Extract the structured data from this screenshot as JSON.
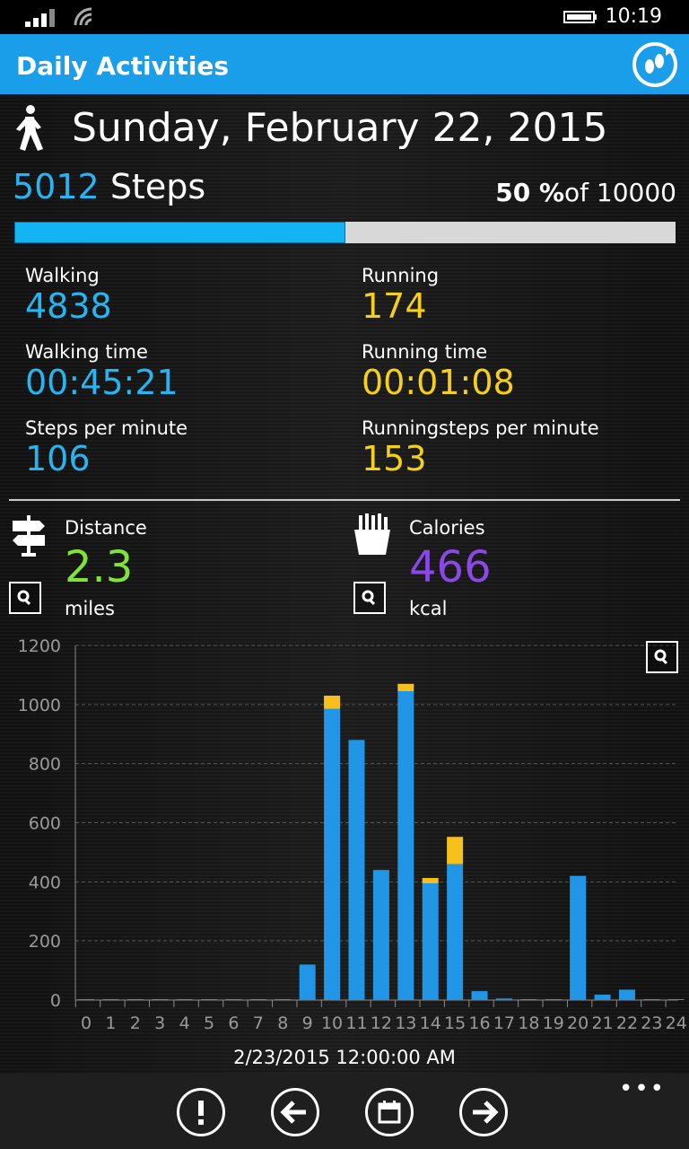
{
  "status": {
    "time": "10:19"
  },
  "header": {
    "title": "Daily Activities"
  },
  "date": "Sunday, February 22, 2015",
  "steps": {
    "count": "5012",
    "label": "Steps",
    "percent": "50 %",
    "goal_text": "of 10000",
    "progress": 0.5
  },
  "stats": {
    "walking_label": "Walking",
    "walking_value": "4838",
    "running_label": "Running",
    "running_value": "174",
    "walking_time_label": "Walking time",
    "walking_time_value": "00:45:21",
    "running_time_label": "Running time",
    "running_time_value": "00:01:08",
    "spm_label": "Steps per minute",
    "spm_value": "106",
    "rspm_label": "Runningsteps per minute",
    "rspm_value": "153"
  },
  "distance": {
    "label": "Distance",
    "value": "2.3",
    "unit": "miles"
  },
  "calories": {
    "label": "Calories",
    "value": "466",
    "unit": "kcal"
  },
  "colors": {
    "header": "#1b9ee9",
    "walking": "#28b4f0",
    "running": "#f4cf1c",
    "distance": "#7fe33a",
    "calories": "#8a49e6",
    "bar_walk": "#2196e6",
    "bar_run": "#f7c01c"
  },
  "chart_data": {
    "type": "bar",
    "stacked": true,
    "categories": [
      "0",
      "1",
      "2",
      "3",
      "4",
      "5",
      "6",
      "7",
      "8",
      "9",
      "10",
      "11",
      "12",
      "13",
      "14",
      "15",
      "16",
      "17",
      "18",
      "19",
      "20",
      "21",
      "22",
      "23",
      "24"
    ],
    "series": [
      {
        "values": [
          0,
          0,
          0,
          0,
          0,
          0,
          0,
          0,
          0,
          120,
          985,
          880,
          440,
          1045,
          395,
          460,
          30,
          5,
          0,
          0,
          420,
          18,
          35,
          0,
          0
        ]
      },
      {
        "values": [
          0,
          0,
          0,
          0,
          0,
          0,
          0,
          0,
          0,
          0,
          45,
          0,
          0,
          25,
          18,
          92,
          0,
          0,
          0,
          0,
          0,
          0,
          0,
          0,
          0
        ]
      }
    ],
    "ylim": [
      0,
      1200
    ],
    "yticks": [
      0,
      200,
      400,
      600,
      800,
      1000,
      1200
    ],
    "grid": true,
    "xlabel": "2/23/2015 12:00:00 AM"
  }
}
